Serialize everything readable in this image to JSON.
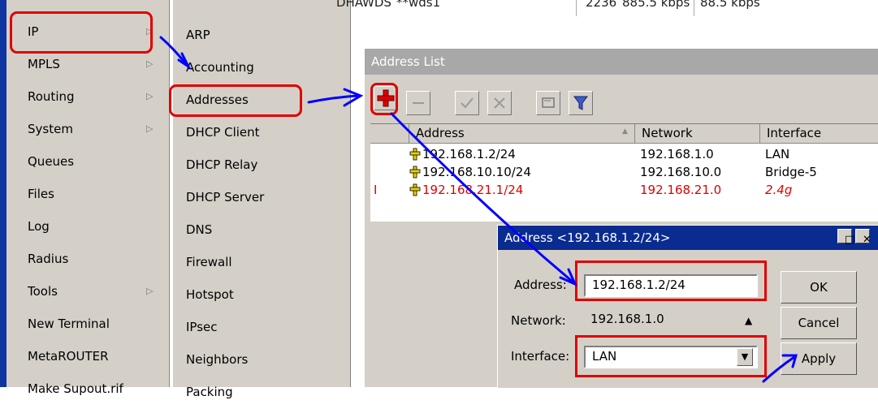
{
  "top_strip": {
    "col1": "DHA",
    "col2": "**wds1",
    "col3": "WDS",
    "col4": "2236",
    "col5": "885.5 kbps",
    "col6": "88.5 kbps"
  },
  "main_menu": {
    "items": [
      {
        "label": "IP",
        "submenu": true
      },
      {
        "label": "MPLS",
        "submenu": true
      },
      {
        "label": "Routing",
        "submenu": true
      },
      {
        "label": "System",
        "submenu": true
      },
      {
        "label": "Queues",
        "submenu": false
      },
      {
        "label": "Files",
        "submenu": false
      },
      {
        "label": "Log",
        "submenu": false
      },
      {
        "label": "Radius",
        "submenu": false
      },
      {
        "label": "Tools",
        "submenu": true
      },
      {
        "label": "New Terminal",
        "submenu": false
      },
      {
        "label": "MetaROUTER",
        "submenu": false
      },
      {
        "label": "Make Supout.rif",
        "submenu": false
      }
    ],
    "arrow_glyph": "▷"
  },
  "sub_menu": {
    "items": [
      "ARP",
      "Accounting",
      "Addresses",
      "DHCP Client",
      "DHCP Relay",
      "DHCP Server",
      "DNS",
      "Firewall",
      "Hotspot",
      "IPsec",
      "Neighbors",
      "Packing"
    ]
  },
  "address_list": {
    "title": "Address List",
    "toolbar": [
      "add-icon",
      "remove-icon",
      "enable-icon",
      "disable-icon",
      "comment-icon",
      "filter-icon"
    ],
    "columns": [
      "",
      "Address",
      "Network",
      "Interface"
    ],
    "sort_glyph": "▲",
    "rows": [
      {
        "flag": "",
        "address": "192.168.1.2/24",
        "network": "192.168.1.0",
        "interface": "LAN",
        "disabled": false
      },
      {
        "flag": "",
        "address": "192.168.10.10/24",
        "network": "192.168.10.0",
        "interface": "Bridge-5",
        "disabled": false
      },
      {
        "flag": "I",
        "address": "192.168.21.1/24",
        "network": "192.168.21.0",
        "interface": "2.4g",
        "disabled": true
      }
    ]
  },
  "dialog": {
    "title": "Address <192.168.1.2/24>",
    "address_label": "Address:",
    "address_value": "192.168.1.2/24",
    "network_label": "Network:",
    "network_value": "192.168.1.0",
    "interface_label": "Interface:",
    "interface_value": "LAN",
    "ok_label": "OK",
    "cancel_label": "Cancel",
    "apply_label": "Apply"
  },
  "colors": {
    "highlight_red": "#e00000",
    "arrow_blue": "#0000ff",
    "title_blue": "#0a2b8f",
    "panel_gray": "#d4d0c8"
  }
}
